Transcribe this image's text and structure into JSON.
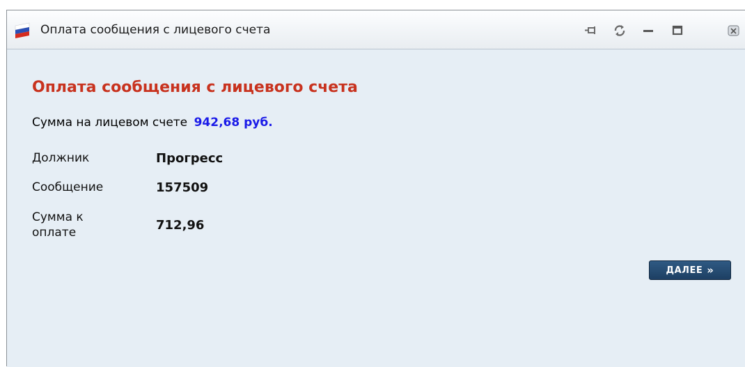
{
  "window": {
    "title": "Оплата сообщения с лицевого счета",
    "controls": [
      "pin-icon",
      "refresh-icon",
      "minimize-icon",
      "maximize-icon",
      "close-icon"
    ]
  },
  "main": {
    "heading": "Оплата сообщения с лицевого счета",
    "balance_label": "Сумма на лицевом счете",
    "balance_value": "942‚68 руб.",
    "fields": [
      {
        "label": "Должник",
        "value": "Прогресс"
      },
      {
        "label": "Сообщение",
        "value": "157509"
      },
      {
        "label_line1": "Сумма к",
        "label_line2": "оплате",
        "value": "712,96"
      }
    ],
    "next_button": {
      "label": "ДАЛЕЕ",
      "arrow": "»"
    }
  },
  "colors": {
    "heading": "#c8321e",
    "balance": "#1a1ae8",
    "button": "#1d3f63",
    "background": "#e6eef5"
  }
}
